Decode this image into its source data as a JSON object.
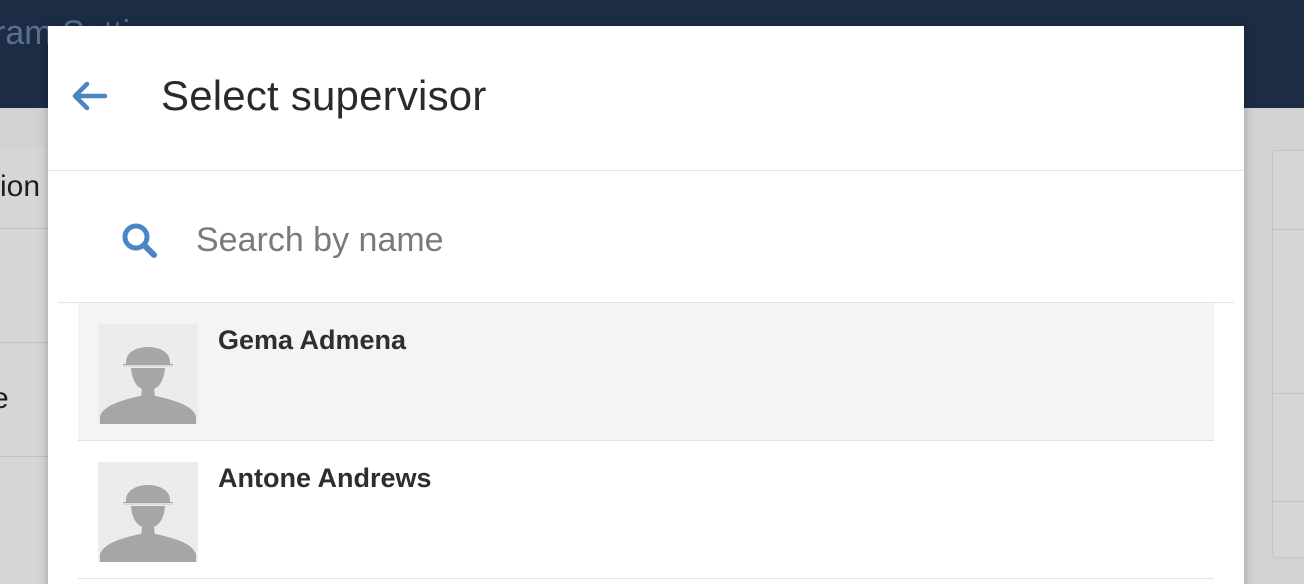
{
  "background": {
    "header_title": "ram Setti",
    "left_fragments": [
      "ion",
      "e"
    ]
  },
  "modal": {
    "title": "Select supervisor",
    "back_icon": "arrow-left-icon",
    "accent_color": "#4a86c5"
  },
  "search": {
    "placeholder": "Search by name",
    "value": "",
    "icon": "search-icon"
  },
  "supervisors": [
    {
      "name": "Gema Admena",
      "avatar_icon": "worker-silhouette-icon",
      "highlighted": true
    },
    {
      "name": "Antone Andrews",
      "avatar_icon": "worker-silhouette-icon",
      "highlighted": false
    }
  ]
}
